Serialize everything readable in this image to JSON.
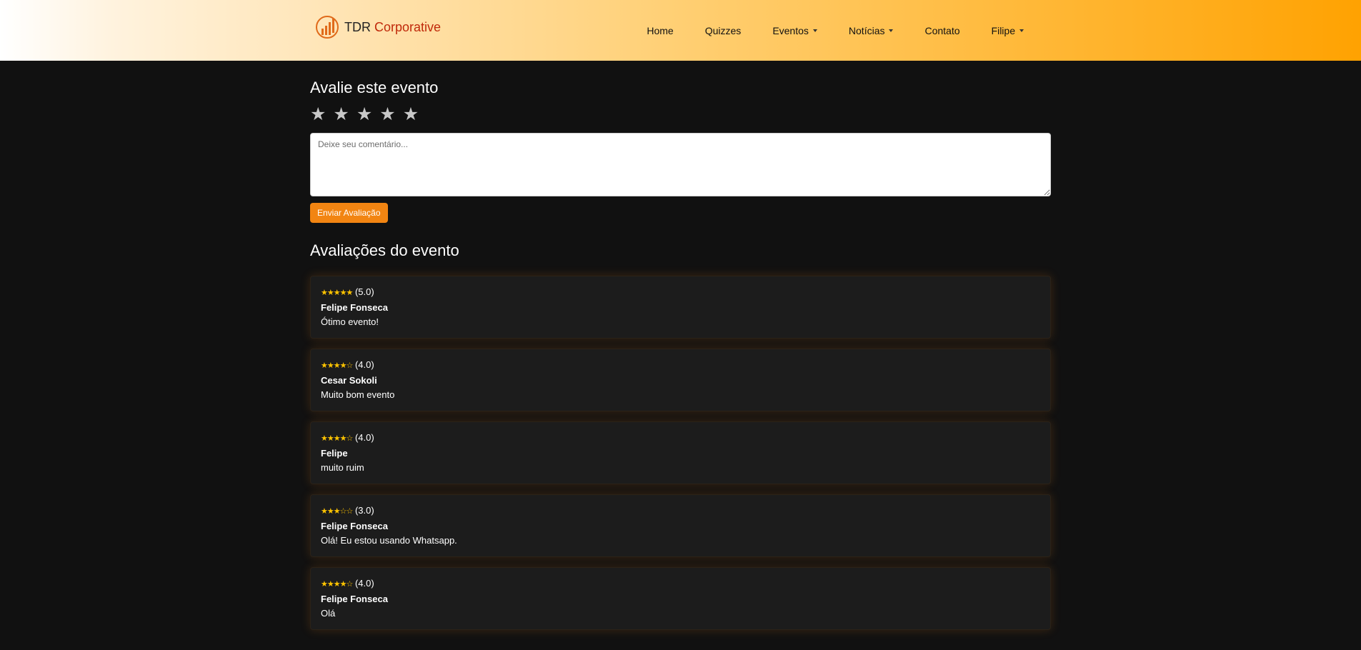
{
  "navbar": {
    "brand_prefix": "TDR",
    "brand_accent": "Corporative",
    "links": [
      {
        "label": "Home"
      },
      {
        "label": "Quizzes"
      },
      {
        "label": "Eventos"
      },
      {
        "label": "Notícias"
      },
      {
        "label": "Contato"
      },
      {
        "label": "Filipe"
      }
    ]
  },
  "rate": {
    "title": "Avalie este evento",
    "star_glyph": "★",
    "comment_placeholder": "Deixe seu comentário...",
    "submit_label": "Enviar Avaliação"
  },
  "reviews": {
    "title": "Avaliações do evento",
    "items": [
      {
        "stars": "★★★★★",
        "score": "(5.0)",
        "author": "Felipe Fonseca",
        "text": "Ótimo evento!"
      },
      {
        "stars": "★★★★☆",
        "score": "(4.0)",
        "author": "Cesar Sokoli",
        "text": "Muito bom evento"
      },
      {
        "stars": "★★★★☆",
        "score": "(4.0)",
        "author": "Felipe",
        "text": "muito ruim"
      },
      {
        "stars": "★★★☆☆",
        "score": "(3.0)",
        "author": "Felipe Fonseca",
        "text": "Olá! Eu estou usando Whatsapp."
      },
      {
        "stars": "★★★★☆",
        "score": "(4.0)",
        "author": "Felipe Fonseca",
        "text": "Olá"
      }
    ]
  },
  "colors": {
    "accent": "#f28512",
    "brand_red": "#c0290a",
    "star_gold": "#ffc400",
    "page_bg": "#111111",
    "card_bg": "#1c1c1c"
  },
  "icons": {
    "logo": "bar-chart-circle-icon",
    "dropdown": "caret-down-icon",
    "star": "star-icon"
  }
}
